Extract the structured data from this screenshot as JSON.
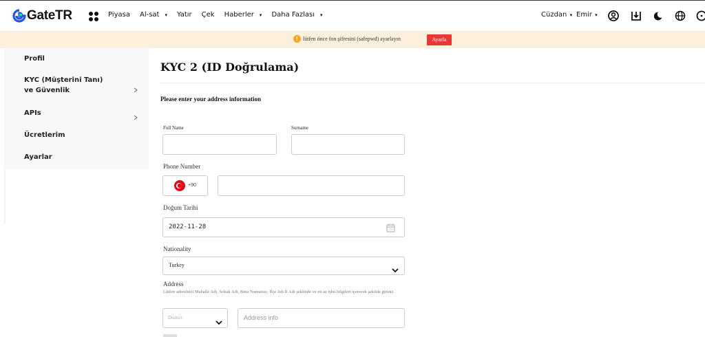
{
  "brand": {
    "name": "GateTR"
  },
  "nav": {
    "items": [
      {
        "label": "Piyasa",
        "caret": false
      },
      {
        "label": "Al-sat",
        "caret": true
      },
      {
        "label": "Yatır",
        "caret": false
      },
      {
        "label": "Çek",
        "caret": false
      },
      {
        "label": "Haberler",
        "caret": true
      },
      {
        "label": "Daha Fazlası",
        "caret": true
      }
    ],
    "wallet_label": "Cüzdan",
    "orders_label": "Emir",
    "caret_glyph": "▾",
    "icons": [
      "account-icon",
      "download-icon",
      "theme-moon-icon",
      "language-globe-icon",
      "more-icon"
    ]
  },
  "notice": {
    "text": "lütfen önce fon şifresini (safepwd) ayarlayın",
    "button_label": "Ayarla",
    "icon": "!",
    "colors": {
      "bar": "#fcf0dc",
      "button": "#e53935",
      "icon": "#f5a623"
    }
  },
  "sidebar": {
    "items": [
      {
        "label": "Profil",
        "chevron": false
      },
      {
        "label": "KYC (Müşterini Tanı) ve Güvenlik",
        "chevron": true
      },
      {
        "label": "APIs",
        "chevron": true
      },
      {
        "label": "Ücretlerim",
        "chevron": false
      },
      {
        "label": "Ayarlar",
        "chevron": false
      }
    ]
  },
  "main": {
    "title": "KYC 2 (ID Doğrulama)",
    "section_title": "Please enter your address information",
    "full_name": {
      "label": "Full Name",
      "value": ""
    },
    "surname": {
      "label": "Surname",
      "value": ""
    },
    "phone": {
      "label": "Phone Number",
      "country_code": "+90",
      "value": ""
    },
    "birth_date": {
      "label": "Doğum Tarihi",
      "value": "2022-11-28"
    },
    "nationality": {
      "label": "Nationality",
      "value": "Turkey"
    },
    "address": {
      "label": "Address",
      "hint": "Lütfen adresinizi Mahalle Adı, Sokak Adı, Bina Numarası, İlçe Adı İl Adı şeklinde ve en az işbu bilgileri içerecek şekilde giriniz.",
      "district_placeholder": "District",
      "info_placeholder": "Address info"
    }
  }
}
